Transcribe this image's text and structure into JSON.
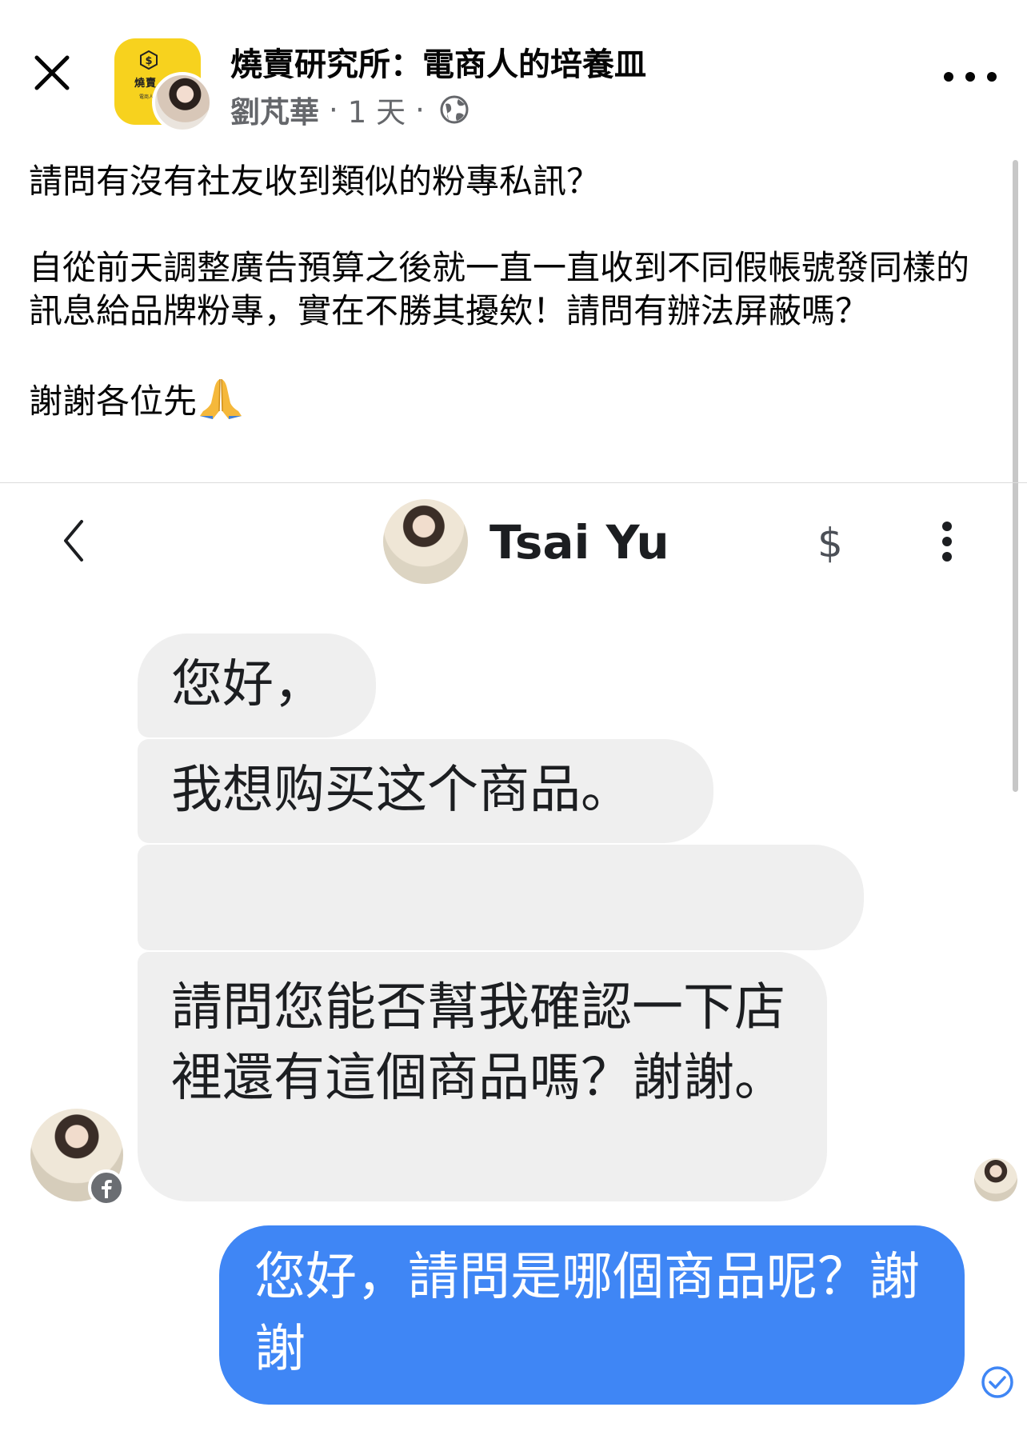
{
  "post": {
    "group_name": "燒賣研究所：電商人的培養皿",
    "group_logo_text": "燒賣",
    "group_logo_sub": "電商人",
    "author": "劉芃華",
    "meta_sep_1": "·",
    "time": "1 天",
    "meta_sep_2": "·",
    "privacy_icon": "globe-icon",
    "body": {
      "paragraph_1": "請問有沒有社友收到類似的粉專私訊？",
      "paragraph_2": "自從前天調整廣告預算之後就一直一直收到不同假帳號發同樣的訊息給品牌粉專，實在不勝其擾欸！請問有辦法屏蔽嗎？",
      "paragraph_3": "謝謝各位先",
      "emoji": "folded-hands-emoji"
    }
  },
  "messenger_screenshot": {
    "contact_name": "Tsai Yu",
    "dollar_label": "$",
    "incoming_messages": [
      {
        "text": "您好，"
      },
      {
        "text": "我想购买这个商品。"
      },
      {
        "text": ""
      },
      {
        "text": "請問您能否幫我確認一下店裡還有這個商品嗎？謝謝。"
      }
    ],
    "outgoing_message": "您好，請問是哪個商品呢？謝謝"
  },
  "colors": {
    "group_logo": "#f7d21e",
    "incoming_bubble": "#efefef",
    "outgoing_bubble": "#3f86f5",
    "meta_text": "#65676b",
    "seen_check": "#3f86f5"
  }
}
